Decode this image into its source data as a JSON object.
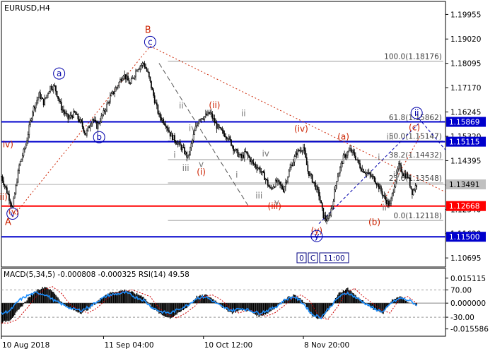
{
  "chart_data": {
    "type": "candlestick",
    "symbol_label": "EURUSD,H4",
    "colors": {
      "candle": "#000000",
      "support_red": "#ff0000",
      "level_blue": "#0000cc",
      "wave_red": "#cc2200",
      "wave_blue": "#0000aa",
      "wave_grey": "#777777",
      "fib": "#999999",
      "macd_hist": "#000000",
      "macd_signal": "#cc0000",
      "rsi": "#1e90ff",
      "current_price_bg": "#c0c0c0"
    },
    "price_axis": {
      "range": [
        1.1035,
        1.2045
      ],
      "ticks": [
        "1.19955",
        "1.19020",
        "1.18095",
        "1.17170",
        "1.16245",
        "1.15320",
        "1.14395",
        "1.13470",
        "1.12540",
        "1.11620",
        "1.10695"
      ]
    },
    "time_axis": {
      "range": [
        0,
        400
      ],
      "labels": [
        {
          "t": 0,
          "label": "10 Aug 2018"
        },
        {
          "t": 92,
          "label": "11 Sep 04:00"
        },
        {
          "t": 182,
          "label": "10 Oct 12:00"
        },
        {
          "t": 272,
          "label": "8 Nov 20:00"
        }
      ]
    },
    "price_path": [
      [
        0,
        1.138
      ],
      [
        6,
        1.131
      ],
      [
        10,
        1.126
      ],
      [
        16,
        1.142
      ],
      [
        22,
        1.15
      ],
      [
        28,
        1.163
      ],
      [
        34,
        1.169
      ],
      [
        38,
        1.166
      ],
      [
        44,
        1.172
      ],
      [
        48,
        1.172
      ],
      [
        54,
        1.164
      ],
      [
        60,
        1.16
      ],
      [
        66,
        1.162
      ],
      [
        72,
        1.158
      ],
      [
        76,
        1.154
      ],
      [
        82,
        1.16
      ],
      [
        86,
        1.157
      ],
      [
        92,
        1.162
      ],
      [
        98,
        1.168
      ],
      [
        104,
        1.172
      ],
      [
        110,
        1.177
      ],
      [
        116,
        1.173
      ],
      [
        122,
        1.179
      ],
      [
        128,
        1.181
      ],
      [
        132,
        1.177
      ],
      [
        138,
        1.167
      ],
      [
        142,
        1.161
      ],
      [
        148,
        1.158
      ],
      [
        152,
        1.154
      ],
      [
        158,
        1.151
      ],
      [
        164,
        1.148
      ],
      [
        168,
        1.145
      ],
      [
        174,
        1.155
      ],
      [
        178,
        1.16
      ],
      [
        184,
        1.161
      ],
      [
        188,
        1.162
      ],
      [
        194,
        1.157
      ],
      [
        198,
        1.155
      ],
      [
        204,
        1.153
      ],
      [
        210,
        1.148
      ],
      [
        216,
        1.145
      ],
      [
        220,
        1.147
      ],
      [
        226,
        1.143
      ],
      [
        232,
        1.141
      ],
      [
        238,
        1.137
      ],
      [
        242,
        1.133
      ],
      [
        248,
        1.136
      ],
      [
        254,
        1.133
      ],
      [
        260,
        1.141
      ],
      [
        266,
        1.147
      ],
      [
        272,
        1.149
      ],
      [
        276,
        1.14
      ],
      [
        282,
        1.135
      ],
      [
        286,
        1.131
      ],
      [
        290,
        1.123
      ],
      [
        294,
        1.121
      ],
      [
        298,
        1.127
      ],
      [
        302,
        1.137
      ],
      [
        308,
        1.145
      ],
      [
        314,
        1.148
      ],
      [
        318,
        1.146
      ],
      [
        324,
        1.141
      ],
      [
        330,
        1.139
      ],
      [
        336,
        1.137
      ],
      [
        340,
        1.134
      ],
      [
        346,
        1.129
      ],
      [
        350,
        1.127
      ],
      [
        354,
        1.135
      ],
      [
        358,
        1.142
      ],
      [
        362,
        1.139
      ],
      [
        366,
        1.138
      ],
      [
        370,
        1.132
      ],
      [
        374,
        1.1349
      ]
    ],
    "horizontal_levels": [
      {
        "price": 1.15869,
        "label": "1.15869",
        "style": "blue"
      },
      {
        "price": 1.15115,
        "label": "1.15115",
        "style": "blue"
      },
      {
        "price": 1.12668,
        "label": "1.12668",
        "style": "red"
      },
      {
        "price": 1.115,
        "label": "1.11500",
        "style": "blue"
      }
    ],
    "current_price": {
      "price": 1.13491,
      "label": "1.13491"
    },
    "fibonacci": {
      "t_start": 150,
      "t_end": 398,
      "levels": [
        {
          "price": 1.18176,
          "label": "100.0(1.18176)"
        },
        {
          "price": 1.15862,
          "label": "61.8(1.15862)"
        },
        {
          "price": 1.15147,
          "label": "50.0(1.15147)"
        },
        {
          "price": 1.14432,
          "label": "38.2(1.14432)"
        },
        {
          "price": 1.13548,
          "label": "23.6(1.13548)"
        },
        {
          "price": 1.12118,
          "label": "0.0(1.12118)"
        }
      ]
    },
    "wave_labels": [
      {
        "text": "B",
        "t": 132,
        "p": 1.1925,
        "color": "wave_red",
        "circle": false,
        "size": 13
      },
      {
        "text": "A",
        "t": 6,
        "p": 1.1195,
        "color": "wave_red",
        "circle": false,
        "size": 13
      },
      {
        "text": "c",
        "t": 134,
        "p": 1.188,
        "color": "wave_blue",
        "circle": true,
        "size": 12
      },
      {
        "text": "a",
        "t": 52,
        "p": 1.176,
        "color": "wave_blue",
        "circle": true,
        "size": 12
      },
      {
        "text": "b",
        "t": 88,
        "p": 1.1518,
        "color": "wave_blue",
        "circle": true,
        "size": 12
      },
      {
        "text": "v",
        "t": 10,
        "p": 1.1227,
        "color": "wave_blue",
        "circle": true,
        "size": 12
      },
      {
        "text": "iv)",
        "t": 6,
        "p": 1.149,
        "color": "wave_red",
        "circle": false,
        "size": 12
      },
      {
        "text": "ii)",
        "t": 2,
        "p": 1.129,
        "color": "wave_red",
        "circle": false,
        "size": 12
      },
      {
        "text": "(v)",
        "t": 11,
        "p": 1.1237,
        "color": "wave_red",
        "circle": false,
        "size": 11
      },
      {
        "text": "(ii)",
        "t": 192,
        "p": 1.164,
        "color": "wave_red",
        "circle": false,
        "size": 12
      },
      {
        "text": "(i)",
        "t": 180,
        "p": 1.1385,
        "color": "wave_red",
        "circle": false,
        "size": 12
      },
      {
        "text": "(iv)",
        "t": 270,
        "p": 1.155,
        "color": "wave_red",
        "circle": false,
        "size": 12
      },
      {
        "text": "(iii)",
        "t": 246,
        "p": 1.1255,
        "color": "wave_red",
        "circle": false,
        "size": 12
      },
      {
        "text": "(a)",
        "t": 308,
        "p": 1.152,
        "color": "wave_red",
        "circle": false,
        "size": 12
      },
      {
        "text": "(b)",
        "t": 336,
        "p": 1.1195,
        "color": "wave_red",
        "circle": false,
        "size": 12
      },
      {
        "text": "(c)",
        "t": 372,
        "p": 1.1555,
        "color": "wave_red",
        "circle": false,
        "size": 12
      },
      {
        "text": "(y)",
        "t": 284,
        "p": 1.1162,
        "color": "wave_red",
        "circle": false,
        "size": 12
      },
      {
        "text": "y",
        "t": 284,
        "p": 1.1142,
        "color": "wave_blue",
        "circle": true,
        "size": 12
      },
      {
        "text": "ii",
        "t": 374,
        "p": 1.161,
        "color": "wave_blue",
        "circle": true,
        "size": 12
      },
      {
        "text": "ii",
        "t": 162,
        "p": 1.1638,
        "color": "wave_grey",
        "circle": false,
        "size": 12
      },
      {
        "text": "iv",
        "t": 172,
        "p": 1.1552,
        "color": "wave_grey",
        "circle": false,
        "size": 12
      },
      {
        "text": "i",
        "t": 156,
        "p": 1.145,
        "color": "wave_grey",
        "circle": false,
        "size": 12
      },
      {
        "text": "iii",
        "t": 166,
        "p": 1.14,
        "color": "wave_grey",
        "circle": false,
        "size": 12
      },
      {
        "text": "v",
        "t": 180,
        "p": 1.1415,
        "color": "wave_grey",
        "circle": false,
        "size": 12
      },
      {
        "text": "ii",
        "t": 218,
        "p": 1.1608,
        "color": "wave_grey",
        "circle": false,
        "size": 12
      },
      {
        "text": "iv",
        "t": 238,
        "p": 1.1455,
        "color": "wave_grey",
        "circle": false,
        "size": 12
      },
      {
        "text": "i",
        "t": 212,
        "p": 1.1375,
        "color": "wave_grey",
        "circle": false,
        "size": 12
      },
      {
        "text": "iii",
        "t": 232,
        "p": 1.1295,
        "color": "wave_grey",
        "circle": false,
        "size": 12
      },
      {
        "text": "v",
        "t": 248,
        "p": 1.127,
        "color": "wave_grey",
        "circle": false,
        "size": 12
      },
      {
        "text": "iii",
        "t": 350,
        "p": 1.152,
        "color": "wave_grey",
        "circle": false,
        "size": 12
      },
      {
        "text": "i",
        "t": 340,
        "p": 1.144,
        "color": "wave_grey",
        "circle": false,
        "size": 12
      },
      {
        "text": "iv",
        "t": 356,
        "p": 1.1375,
        "color": "wave_grey",
        "circle": false,
        "size": 12
      },
      {
        "text": "ii",
        "t": 345,
        "p": 1.125,
        "color": "wave_grey",
        "circle": false,
        "size": 12
      }
    ],
    "trend_lines": [
      {
        "points": [
          [
            10,
            1.1225
          ],
          [
            134,
            1.1875
          ]
        ],
        "color": "wave_red",
        "dash": "2,3"
      },
      {
        "points": [
          [
            134,
            1.1875
          ],
          [
            400,
            1.132
          ]
        ],
        "color": "wave_red",
        "dash": "2,3"
      },
      {
        "points": [
          [
            142,
            1.181
          ],
          [
            222,
            1.127
          ]
        ],
        "color": "#555555",
        "dash": "7,4"
      },
      {
        "points": [
          [
            286,
            1.12
          ],
          [
            378,
            1.159
          ]
        ],
        "color": "wave_blue",
        "dash": "4,3"
      },
      {
        "points": [
          [
            376,
            1.16
          ],
          [
            400,
            1.148
          ]
        ],
        "color": "wave_blue",
        "dash": "4,3"
      },
      {
        "points": [
          [
            342,
            1.127
          ],
          [
            378,
            1.154
          ]
        ],
        "color": "wave_red",
        "dash": "2,3"
      }
    ],
    "period_tabs": [
      "0",
      "C",
      "11:00"
    ],
    "indicator": {
      "label": "MACD(5,34,5) -0.000808 -0.000325 RSI(14) 49.58",
      "range": [
        -0.02,
        0.021
      ],
      "ticks": [
        "0.015115",
        "70.00",
        "0.000000",
        "-30.00",
        "-0.015586"
      ],
      "tick_values": [
        0.015115,
        0.008,
        0.0,
        -0.0085,
        -0.015586
      ],
      "macd_hist": [
        [
          0,
          -0.012
        ],
        [
          8,
          -0.01
        ],
        [
          16,
          -0.004
        ],
        [
          24,
          0.003
        ],
        [
          32,
          0.008
        ],
        [
          40,
          0.01
        ],
        [
          48,
          0.006
        ],
        [
          56,
          -0.001
        ],
        [
          64,
          -0.004
        ],
        [
          72,
          -0.006
        ],
        [
          80,
          -0.003
        ],
        [
          88,
          0.002
        ],
        [
          96,
          0.006
        ],
        [
          104,
          0.007
        ],
        [
          112,
          0.008
        ],
        [
          120,
          0.006
        ],
        [
          128,
          0.004
        ],
        [
          136,
          -0.003
        ],
        [
          144,
          -0.007
        ],
        [
          152,
          -0.009
        ],
        [
          160,
          -0.006
        ],
        [
          168,
          -0.002
        ],
        [
          176,
          0.004
        ],
        [
          184,
          0.005
        ],
        [
          192,
          0.002
        ],
        [
          200,
          -0.003
        ],
        [
          208,
          -0.006
        ],
        [
          216,
          -0.004
        ],
        [
          224,
          -0.005
        ],
        [
          232,
          -0.008
        ],
        [
          240,
          -0.006
        ],
        [
          248,
          -0.002
        ],
        [
          256,
          0.003
        ],
        [
          264,
          0.005
        ],
        [
          272,
          0.001
        ],
        [
          280,
          -0.008
        ],
        [
          288,
          -0.01
        ],
        [
          296,
          -0.003
        ],
        [
          304,
          0.006
        ],
        [
          312,
          0.009
        ],
        [
          320,
          0.004
        ],
        [
          328,
          0.0
        ],
        [
          336,
          -0.004
        ],
        [
          344,
          -0.006
        ],
        [
          352,
          0.002
        ],
        [
          360,
          0.004
        ],
        [
          368,
          0.0
        ],
        [
          374,
          -0.001
        ]
      ],
      "rsi": [
        [
          0,
          35
        ],
        [
          8,
          40
        ],
        [
          16,
          55
        ],
        [
          24,
          62
        ],
        [
          32,
          66
        ],
        [
          40,
          63
        ],
        [
          48,
          54
        ],
        [
          56,
          48
        ],
        [
          64,
          42
        ],
        [
          72,
          40
        ],
        [
          80,
          46
        ],
        [
          88,
          55
        ],
        [
          96,
          62
        ],
        [
          104,
          64
        ],
        [
          112,
          66
        ],
        [
          120,
          60
        ],
        [
          128,
          55
        ],
        [
          136,
          44
        ],
        [
          144,
          38
        ],
        [
          152,
          36
        ],
        [
          160,
          42
        ],
        [
          168,
          48
        ],
        [
          176,
          58
        ],
        [
          184,
          60
        ],
        [
          192,
          52
        ],
        [
          200,
          44
        ],
        [
          208,
          40
        ],
        [
          216,
          43
        ],
        [
          224,
          40
        ],
        [
          232,
          36
        ],
        [
          240,
          40
        ],
        [
          248,
          46
        ],
        [
          256,
          56
        ],
        [
          264,
          60
        ],
        [
          272,
          50
        ],
        [
          280,
          34
        ],
        [
          288,
          30
        ],
        [
          296,
          45
        ],
        [
          304,
          60
        ],
        [
          312,
          66
        ],
        [
          320,
          58
        ],
        [
          328,
          50
        ],
        [
          336,
          42
        ],
        [
          344,
          38
        ],
        [
          352,
          52
        ],
        [
          360,
          58
        ],
        [
          368,
          54
        ],
        [
          374,
          48
        ]
      ]
    }
  }
}
